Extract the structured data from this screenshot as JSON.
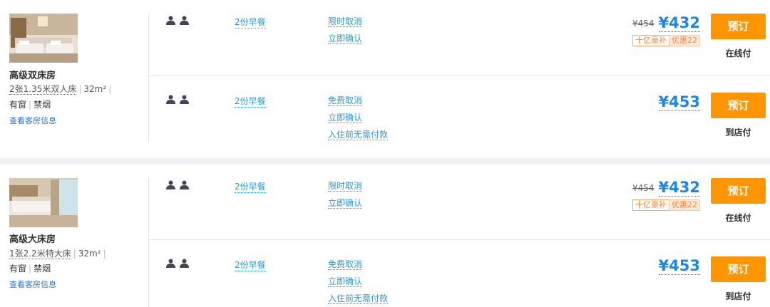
{
  "colors": {
    "accent": "#1c87e6",
    "link": "#2a9bd3",
    "book": "#ff9500",
    "tag": "#f08a3c"
  },
  "rooms": [
    {
      "name": "高级双床房",
      "bed": "2张1.35米双人床",
      "area": "32m²",
      "window": "有窗",
      "smoking": "禁烟",
      "info_link": "查看客房信息",
      "rates": [
        {
          "persons_icon": "person-icon",
          "meal": "2份早餐",
          "policies": [
            "限时取消",
            "立即确认"
          ],
          "old_price": "¥454",
          "price": "¥432",
          "tag1": "十亿豪补",
          "tag2": "优惠22",
          "book": "预订",
          "pay": "在线付"
        },
        {
          "persons_icon": "person-icon",
          "meal": "2份早餐",
          "policies": [
            "免费取消",
            "立即确认",
            "入住前无需付款"
          ],
          "price": "¥453",
          "book": "预订",
          "pay": "到店付"
        }
      ]
    },
    {
      "name": "高级大床房",
      "bed": "1张2.2米特大床",
      "area": "32m²",
      "window": "有窗",
      "smoking": "禁烟",
      "info_link": "查看客房信息",
      "rates": [
        {
          "persons_icon": "person-icon",
          "meal": "2份早餐",
          "policies": [
            "限时取消",
            "立即确认"
          ],
          "old_price": "¥454",
          "price": "¥432",
          "tag1": "十亿豪补",
          "tag2": "优惠22",
          "book": "预订",
          "pay": "在线付"
        },
        {
          "persons_icon": "person-icon",
          "meal": "2份早餐",
          "policies": [
            "免费取消",
            "立即确认",
            "入住前无需付款"
          ],
          "price": "¥453",
          "book": "预订",
          "pay": "到店付"
        }
      ]
    }
  ]
}
